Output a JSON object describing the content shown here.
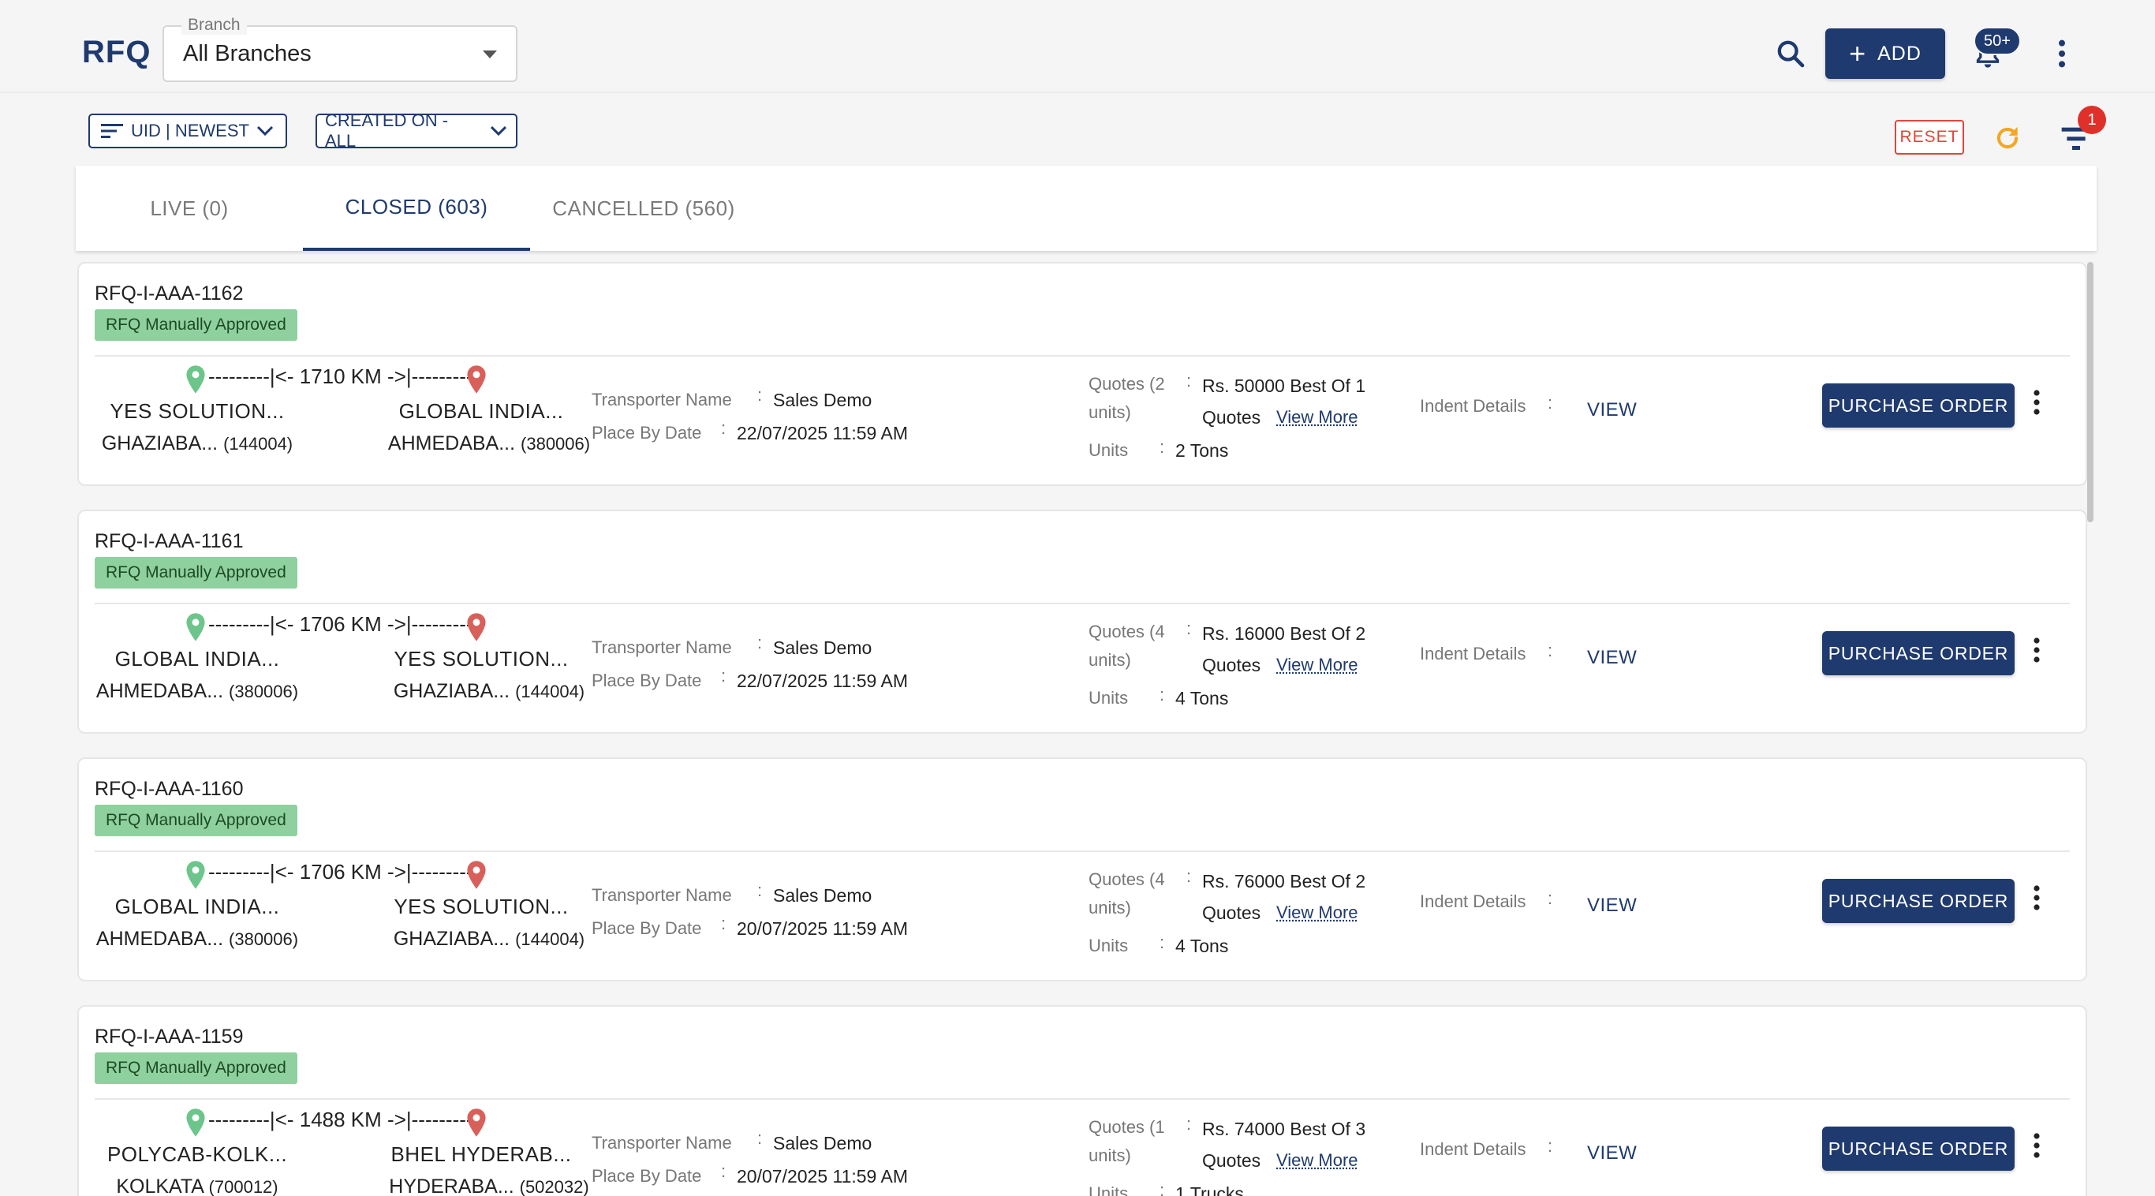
{
  "header": {
    "title": "RFQ",
    "branch_label": "Branch",
    "branch_value": "All Branches",
    "add_label": "ADD",
    "notifications_count": "50+"
  },
  "toolbar": {
    "sort_label": "UID | NEWEST",
    "created_label": "CREATED ON - ALL",
    "reset_label": "RESET",
    "filter_count": "1"
  },
  "tabs": [
    {
      "label": "LIVE (0)",
      "active": false
    },
    {
      "label": "CLOSED (603)",
      "active": true
    },
    {
      "label": "CANCELLED (560)",
      "active": false
    }
  ],
  "labels": {
    "transporter": "Transporter Name",
    "place_by": "Place By Date",
    "quotes_line1": "Quotes (2",
    "units_label": "Units",
    "indent": "Indent Details",
    "view_more": "View More",
    "view": "VIEW",
    "purchase_order": "PURCHASE ORDER",
    "quotes_word": "Quotes"
  },
  "cards": [
    {
      "id": "RFQ-I-AAA-1162",
      "status": "RFQ Manually Approved",
      "distance": "---------|<- 1710 KM ->|---------",
      "origin_name": "YES SOLUTION...",
      "origin_city": "GHAZIABA...",
      "origin_pin": "(144004)",
      "dest_name": "GLOBAL INDIA...",
      "dest_city": "AHMEDABA...",
      "dest_pin": "(380006)",
      "transporter": "Sales Demo",
      "place_by": "22/07/2025 11:59 AM",
      "quotes_head": "Quotes (2",
      "quotes_units": "units)",
      "quote_value": "Rs. 50000 Best Of 1",
      "units": "2 Tons"
    },
    {
      "id": "RFQ-I-AAA-1161",
      "status": "RFQ Manually Approved",
      "distance": "---------|<- 1706 KM ->|---------",
      "origin_name": "GLOBAL INDIA...",
      "origin_city": "AHMEDABA...",
      "origin_pin": "(380006)",
      "dest_name": "YES SOLUTION...",
      "dest_city": "GHAZIABA...",
      "dest_pin": "(144004)",
      "transporter": "Sales Demo",
      "place_by": "22/07/2025 11:59 AM",
      "quotes_head": "Quotes (4",
      "quotes_units": "units)",
      "quote_value": "Rs. 16000 Best Of 2",
      "units": "4 Tons"
    },
    {
      "id": "RFQ-I-AAA-1160",
      "status": "RFQ Manually Approved",
      "distance": "---------|<- 1706 KM ->|---------",
      "origin_name": "GLOBAL INDIA...",
      "origin_city": "AHMEDABA...",
      "origin_pin": "(380006)",
      "dest_name": "YES SOLUTION...",
      "dest_city": "GHAZIABA...",
      "dest_pin": "(144004)",
      "transporter": "Sales Demo",
      "place_by": "20/07/2025 11:59 AM",
      "quotes_head": "Quotes (4",
      "quotes_units": "units)",
      "quote_value": "Rs. 76000 Best Of 2",
      "units": "4 Tons"
    },
    {
      "id": "RFQ-I-AAA-1159",
      "status": "RFQ Manually Approved",
      "distance": "---------|<- 1488 KM ->|---------",
      "origin_name": "POLYCAB-KOLK...",
      "origin_city": "KOLKATA",
      "origin_pin": "(700012)",
      "dest_name": "BHEL HYDERAB...",
      "dest_city": "HYDERABA...",
      "dest_pin": "(502032)",
      "transporter": "Sales Demo",
      "place_by": "20/07/2025 11:59 AM",
      "quotes_head": "Quotes (1",
      "quotes_units": "units)",
      "quote_value": "Rs. 74000 Best Of 3",
      "units": "1 Trucks"
    }
  ],
  "colors": {
    "primary": "#1f3a6e",
    "status_bg": "#8fd19e",
    "reset": "#e0463a",
    "refresh": "#f5a623",
    "pin_start": "#6cc58a",
    "pin_end": "#d9605a"
  },
  "icons": [
    "search-icon",
    "plus-icon",
    "bell-icon",
    "kebab-icon",
    "sort-icon",
    "chevron-down-icon",
    "refresh-icon",
    "filter-icon",
    "location-pin-icon"
  ]
}
